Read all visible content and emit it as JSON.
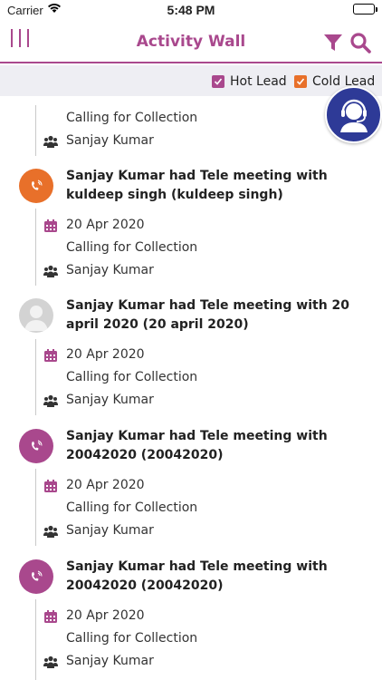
{
  "status_bar": {
    "carrier": "Carrier",
    "time": "5:48 PM"
  },
  "nav": {
    "title": "Activity Wall"
  },
  "lead_filters": {
    "hot_label": "Hot Lead",
    "cold_label": "Cold Lead"
  },
  "colors": {
    "brand": "#a9488d",
    "hot": "#a9488d",
    "cold": "#e8702a",
    "support_fab": "#2e3a97"
  },
  "partial_item": {
    "description": "Calling for Collection",
    "user": "Sanjay Kumar"
  },
  "activities": [
    {
      "title": "Sanjay Kumar had Tele meeting with kuldeep singh (kuldeep singh)",
      "date": "20 Apr 2020",
      "description": "Calling for Collection",
      "user": "Sanjay Kumar",
      "avatar": "phone-orange"
    },
    {
      "title": "Sanjay Kumar had Tele meeting with 20 april 2020 (20 april 2020)",
      "date": "20 Apr 2020",
      "description": "Calling for Collection",
      "user": "Sanjay Kumar",
      "avatar": "person-grey"
    },
    {
      "title": "Sanjay Kumar had Tele meeting with 20042020 (20042020)",
      "date": "20 Apr 2020",
      "description": "Calling for Collection",
      "user": "Sanjay Kumar",
      "avatar": "phone-purple"
    },
    {
      "title": "Sanjay Kumar had Tele meeting with 20042020 (20042020)",
      "date": "20 Apr 2020",
      "description": "Calling for Collection",
      "user": "Sanjay Kumar",
      "avatar": "phone-purple"
    }
  ]
}
